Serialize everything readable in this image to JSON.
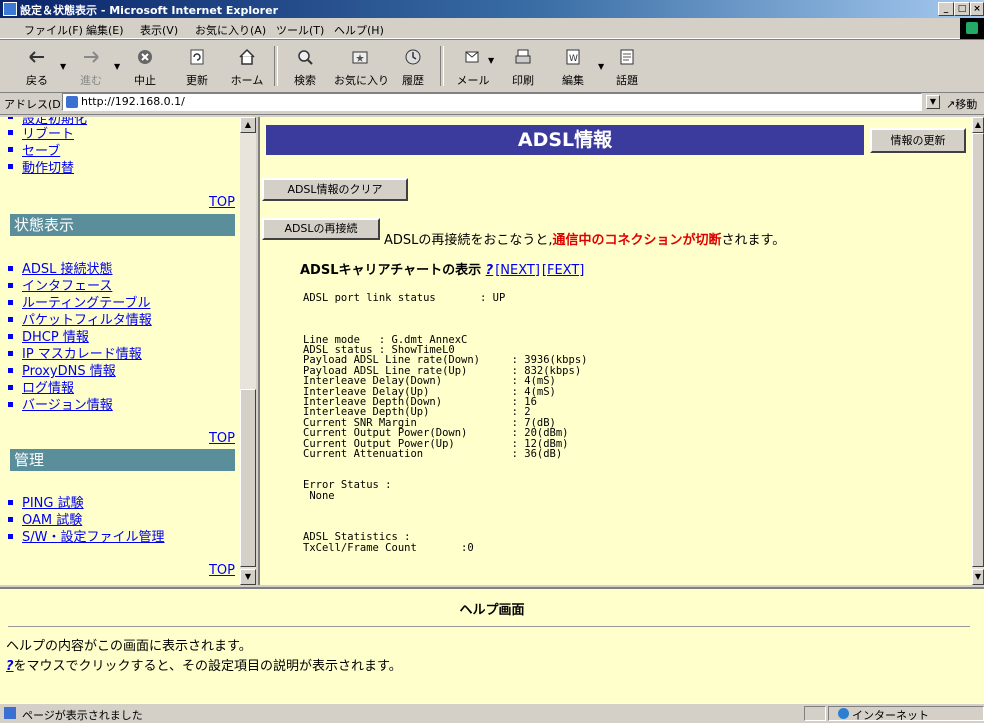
{
  "window": {
    "title": "設定＆状態表示 - Microsoft Internet Explorer",
    "buttons": [
      "_",
      "□",
      "×"
    ]
  },
  "menu": [
    "ファイル(F)",
    "編集(E)",
    "表示(V)",
    "お気に入り(A)",
    "ツール(T)",
    "ヘルプ(H)"
  ],
  "toolbar": {
    "back": "戻る",
    "forward": "進む",
    "stop": "中止",
    "refresh": "更新",
    "home": "ホーム",
    "search": "検索",
    "favorites": "お気に入り",
    "history": "履歴",
    "mail": "メール",
    "print": "印刷",
    "edit": "編集",
    "discuss": "話題"
  },
  "address": {
    "label": "アドレス(D)",
    "url": "http://192.168.0.1/",
    "go": "移動"
  },
  "sidebar": {
    "cut_item": "設定初期化",
    "top_items": [
      "リブート",
      "セーブ",
      "動作切替"
    ],
    "top_link": "TOP",
    "status_heading": "状態表示",
    "status_items": [
      "ADSL 接続状態",
      "インタフェース",
      "ルーティングテーブル",
      "パケットフィルタ情報",
      "DHCP 情報",
      "IP マスカレード情報",
      "ProxyDNS 情報",
      "ログ情報",
      "バージョン情報"
    ],
    "manage_heading": "管理",
    "manage_items": [
      "PING 試験",
      "OAM 試験",
      "S/W・設定ファイル管理"
    ]
  },
  "main": {
    "heading": "ADSL情報",
    "refresh_button": "情報の更新",
    "clear_button": "ADSL情報のクリア",
    "reconnect_button": "ADSLの再接続",
    "reconnect_note_pre": "ADSLの再接続をおこなうと,",
    "reconnect_note_warn": "通信中のコネクションが切断",
    "reconnect_note_post": "されます。",
    "carrier_label": "ADSLキャリアチャートの表示",
    "help_mark": "?",
    "next_link": "[NEXT]",
    "fext_link": "[FEXT]",
    "stats_text": "ADSL port link status       : UP\n\n\n\nLine mode   : G.dmt AnnexC\nADSL status : ShowTimeL0\nPayload ADSL Line rate(Down)     : 3936(kbps)\nPayload ADSL Line rate(Up)       : 832(kbps)\nInterleave Delay(Down)           : 4(mS)\nInterleave Delay(Up)             : 4(mS)\nInterleave Depth(Down)           : 16\nInterleave Depth(Up)             : 2\nCurrent SNR Margin               : 7(dB)\nCurrent Output Power(Down)       : 20(dBm)\nCurrent Output Power(Up)         : 12(dBm)\nCurrent Attenuation              : 36(dB)\n\n\nError Status :\n None\n\n\n\nADSL Statistics :\nTxCell/Frame Count       :0"
  },
  "help": {
    "title": "ヘルプ画面",
    "line1": "ヘルプの内容がこの画面に表示されます。",
    "line2_mark": "?",
    "line2": "をマウスでクリックすると、その設定項目の説明が表示されます。"
  },
  "status": {
    "text": "ページが表示されました",
    "zone": "インターネット"
  }
}
